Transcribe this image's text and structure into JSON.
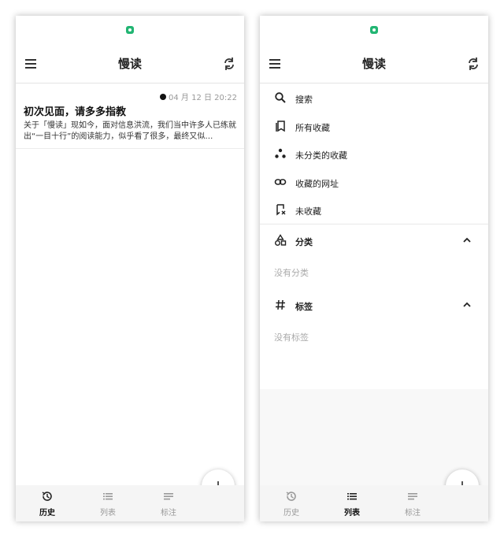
{
  "app": {
    "title": "慢读"
  },
  "history": {
    "articles": [
      {
        "date": "04 月 12 日 20:22",
        "title": "初次见面，请多多指教",
        "excerpt": "关于「慢读」现如今，面对信息洪流，我们当中许多人已练就出“一目十行”的阅读能力，似乎看了很多，最终又似…"
      }
    ]
  },
  "drawer": {
    "items": [
      {
        "label": "搜索",
        "icon": "search-icon"
      },
      {
        "label": "所有收藏",
        "icon": "bookmarks-icon"
      },
      {
        "label": "未分类的收藏",
        "icon": "scatter-dots-icon"
      },
      {
        "label": "收藏的网址",
        "icon": "link-icon"
      },
      {
        "label": "未收藏",
        "icon": "bookmark-off-icon"
      }
    ],
    "categories": {
      "label": "分类",
      "empty": "没有分类",
      "icon": "shapes-icon"
    },
    "tags": {
      "label": "标签",
      "empty": "没有标签",
      "icon": "hash-icon"
    }
  },
  "nav": {
    "tabs": [
      {
        "label": "历史",
        "icon": "history-icon"
      },
      {
        "label": "列表",
        "icon": "list-icon"
      },
      {
        "label": "标注",
        "icon": "notes-icon"
      }
    ]
  },
  "colors": {
    "status_icon": "#22b573",
    "text": "#222222",
    "muted": "#999999"
  }
}
